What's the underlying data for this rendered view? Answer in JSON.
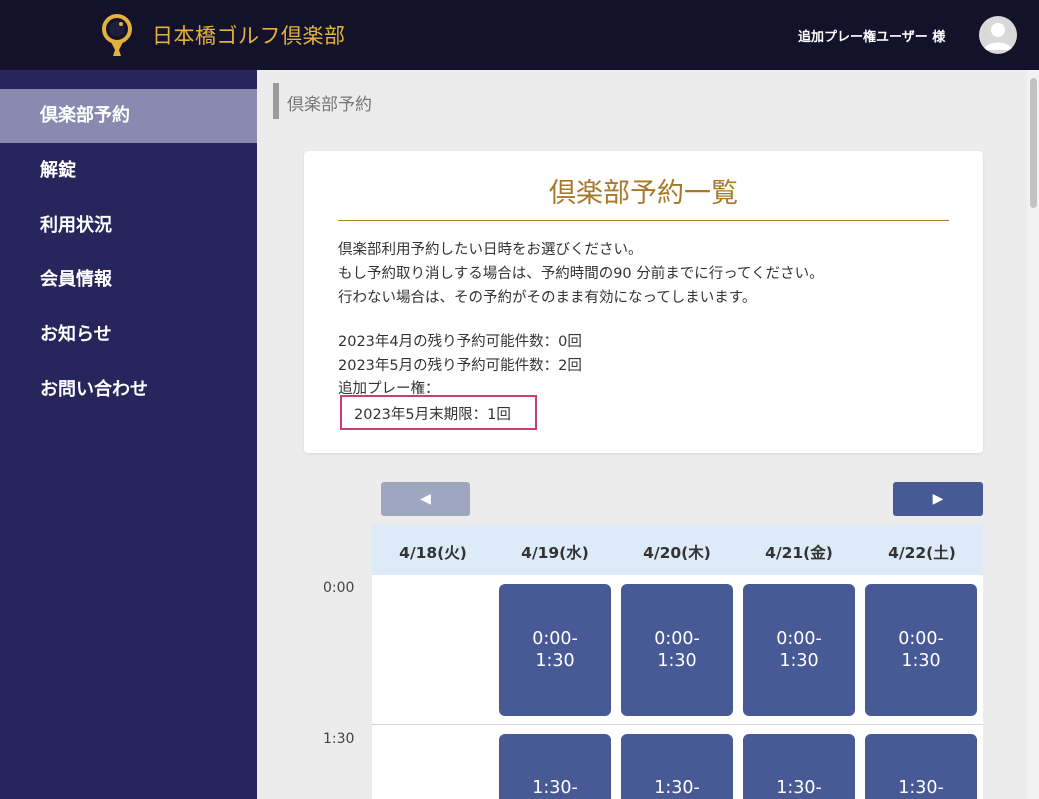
{
  "header": {
    "logo_text": "日本橋ゴルフ倶楽部",
    "user_name": "追加プレー権ユーザー 様"
  },
  "sidebar": {
    "items": [
      {
        "label": "倶楽部予約",
        "active": true
      },
      {
        "label": "解錠",
        "active": false
      },
      {
        "label": "利用状況",
        "active": false
      },
      {
        "label": "会員情報",
        "active": false
      },
      {
        "label": "お知らせ",
        "active": false
      },
      {
        "label": "お問い合わせ",
        "active": false
      }
    ]
  },
  "breadcrumb": "倶楽部予約",
  "card": {
    "title": "倶楽部予約一覧",
    "intro": [
      "倶楽部利用予約したい日時をお選びください。",
      "もし予約取り消しする場合は、予約時間の90 分前までに行ってください。",
      "行わない場合は、その予約がそのまま有効になってしまいます。"
    ],
    "remaining": [
      "2023年4月の残り予約可能件数：0回",
      "2023年5月の残り予約可能件数：2回"
    ],
    "extra_label": "追加プレー権：",
    "extra_value": "2023年5月末期限：1回"
  },
  "calendar": {
    "prev_label": "◀",
    "next_label": "▶",
    "days": [
      "4/18(火)",
      "4/19(水)",
      "4/20(木)",
      "4/21(金)",
      "4/22(土)"
    ],
    "times": [
      "0:00",
      "1:30"
    ],
    "slot_row1": [
      "0:00-",
      "1:30"
    ],
    "slot_row2": [
      "1:30-"
    ]
  },
  "colors": {
    "header_bg": "#13122a",
    "sidebar_bg": "#27265c",
    "active_nav": "#8a8ab0",
    "accent_gold": "#a9792a",
    "slot_blue": "#475a96",
    "highlight": "#c9416a"
  }
}
